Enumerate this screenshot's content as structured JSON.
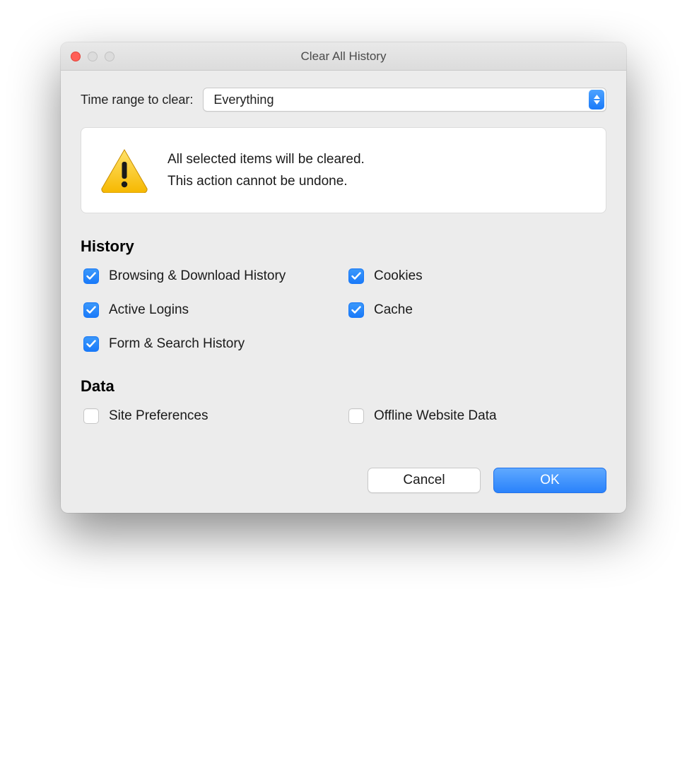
{
  "window": {
    "title": "Clear All History"
  },
  "time_range": {
    "label": "Time range to clear:",
    "value": "Everything"
  },
  "warning": {
    "line1": "All selected items will be cleared.",
    "line2": "This action cannot be undone."
  },
  "sections": {
    "history": {
      "heading": "History",
      "items": [
        {
          "label": "Browsing & Download History",
          "checked": true
        },
        {
          "label": "Cookies",
          "checked": true
        },
        {
          "label": "Active Logins",
          "checked": true
        },
        {
          "label": "Cache",
          "checked": true
        },
        {
          "label": "Form & Search History",
          "checked": true
        }
      ]
    },
    "data": {
      "heading": "Data",
      "items": [
        {
          "label": "Site Preferences",
          "checked": false
        },
        {
          "label": "Offline Website Data",
          "checked": false
        }
      ]
    }
  },
  "buttons": {
    "cancel": "Cancel",
    "ok": "OK"
  }
}
